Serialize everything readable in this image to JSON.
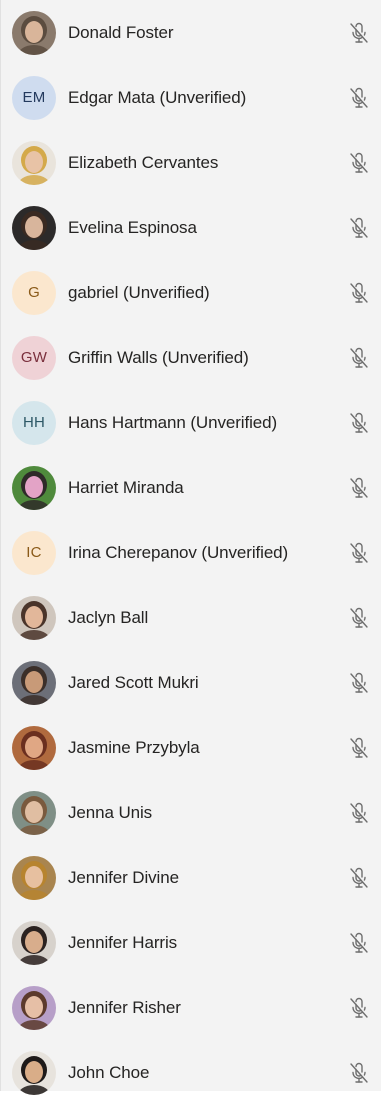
{
  "participants": [
    {
      "name": "Donald Foster",
      "avatar_type": "photo",
      "photo_bg": "#8a7a6c",
      "photo_fg": "#d9b59a",
      "photo_hair": "#5b4c3f"
    },
    {
      "name": "Edgar Mata (Unverified)",
      "avatar_type": "initials",
      "initials": "EM",
      "bg": "#cfdcef",
      "fg": "#243a5e"
    },
    {
      "name": "Elizabeth Cervantes",
      "avatar_type": "photo",
      "photo_bg": "#e9e4dc",
      "photo_fg": "#e8c3a6",
      "photo_hair": "#d4a94a"
    },
    {
      "name": "Evelina Espinosa",
      "avatar_type": "photo",
      "photo_bg": "#2c2a2a",
      "photo_fg": "#d8b59c",
      "photo_hair": "#3a2a22"
    },
    {
      "name": "gabriel (Unverified)",
      "avatar_type": "initials",
      "initials": "G",
      "bg": "#fbe7ce",
      "fg": "#8a5a18"
    },
    {
      "name": "Griffin Walls (Unverified)",
      "avatar_type": "initials",
      "initials": "GW",
      "bg": "#efd2d6",
      "fg": "#7a2f3c"
    },
    {
      "name": "Hans Hartmann (Unverified)",
      "avatar_type": "initials",
      "initials": "HH",
      "bg": "#d5e6ec",
      "fg": "#2d5866"
    },
    {
      "name": "Harriet Miranda",
      "avatar_type": "photo",
      "photo_bg": "#4f8a3c",
      "photo_fg": "#e3a3c6",
      "photo_hair": "#2e2a28"
    },
    {
      "name": "Irina Cherepanov (Unverified)",
      "avatar_type": "initials",
      "initials": "IC",
      "bg": "#fbe7ce",
      "fg": "#8a5a18"
    },
    {
      "name": "Jaclyn Ball",
      "avatar_type": "photo",
      "photo_bg": "#cfc6bd",
      "photo_fg": "#e2b79a",
      "photo_hair": "#4a342a"
    },
    {
      "name": "Jared Scott Mukri",
      "avatar_type": "photo",
      "photo_bg": "#6c6f78",
      "photo_fg": "#c89a78",
      "photo_hair": "#3b2f29"
    },
    {
      "name": "Jasmine Przybyla",
      "avatar_type": "photo",
      "photo_bg": "#b06a3e",
      "photo_fg": "#e0a784",
      "photo_hair": "#6b2f1f"
    },
    {
      "name": "Jenna Unis",
      "avatar_type": "photo",
      "photo_bg": "#7f8f86",
      "photo_fg": "#e0bea2",
      "photo_hair": "#7a5a3e"
    },
    {
      "name": "Jennifer Divine",
      "avatar_type": "photo",
      "photo_bg": "#a9854f",
      "photo_fg": "#e7c0a0",
      "photo_hair": "#b7842f"
    },
    {
      "name": "Jennifer Harris",
      "avatar_type": "photo",
      "photo_bg": "#d7d2cc",
      "photo_fg": "#d8ad8c",
      "photo_hair": "#2b2220"
    },
    {
      "name": "Jennifer Risher",
      "avatar_type": "photo",
      "photo_bg": "#b79fc8",
      "photo_fg": "#e6bfa6",
      "photo_hair": "#5c3a2c"
    },
    {
      "name": "John Choe",
      "avatar_type": "photo",
      "photo_bg": "#e7e3dd",
      "photo_fg": "#d9ad88",
      "photo_hair": "#1e1a19"
    }
  ],
  "mic_icon": "mic-off-icon",
  "colors": {
    "panel_bg": "#f3f3f3",
    "text": "#252423",
    "icon": "#6e6e6e"
  }
}
